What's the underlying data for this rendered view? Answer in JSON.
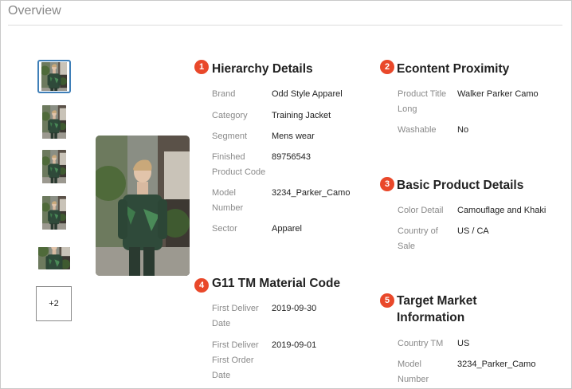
{
  "header": {
    "title": "Overview"
  },
  "gallery": {
    "more_label": "+2",
    "thumbnails": [
      "thumbnail-1",
      "thumbnail-2",
      "thumbnail-3",
      "thumbnail-4",
      "thumbnail-5"
    ]
  },
  "sections": {
    "hierarchy": {
      "number": "1",
      "title": "Hierarchy Details",
      "fields": [
        {
          "label": "Brand",
          "value": "Odd Style Apparel"
        },
        {
          "label": "Category",
          "value": "Training Jacket"
        },
        {
          "label": "Segment",
          "value": "Mens wear"
        },
        {
          "label": "Finished Product Code",
          "value": "89756543"
        },
        {
          "label": "Model Number",
          "value": "3234_Parker_Camo"
        },
        {
          "label": "Sector",
          "value": "Apparel"
        }
      ]
    },
    "econtent": {
      "number": "2",
      "title": "Econtent Proximity",
      "fields": [
        {
          "label": "Product Title Long",
          "value": "Walker Parker Camo"
        },
        {
          "label": "Washable",
          "value": "No"
        }
      ]
    },
    "basic": {
      "number": "3",
      "title": "Basic Product Details",
      "fields": [
        {
          "label": "Color Detail",
          "value": "Camouflage and Khaki"
        },
        {
          "label": "Country of Sale",
          "value": "US / CA"
        }
      ]
    },
    "material": {
      "number": "4",
      "title": "G11 TM Material Code",
      "fields": [
        {
          "label": "First Deliver Date",
          "value": "2019-09-30"
        },
        {
          "label": "First Deliver First Order Date",
          "value": "2019-09-01"
        }
      ]
    },
    "target": {
      "number": "5",
      "title": "Target Market Information",
      "fields": [
        {
          "label": "Country TM",
          "value": "US"
        },
        {
          "label": "Model Number",
          "value": "3234_Parker_Camo"
        }
      ]
    }
  },
  "colors": {
    "badge": "#e9482a",
    "selected_border": "#3f7fb8"
  }
}
